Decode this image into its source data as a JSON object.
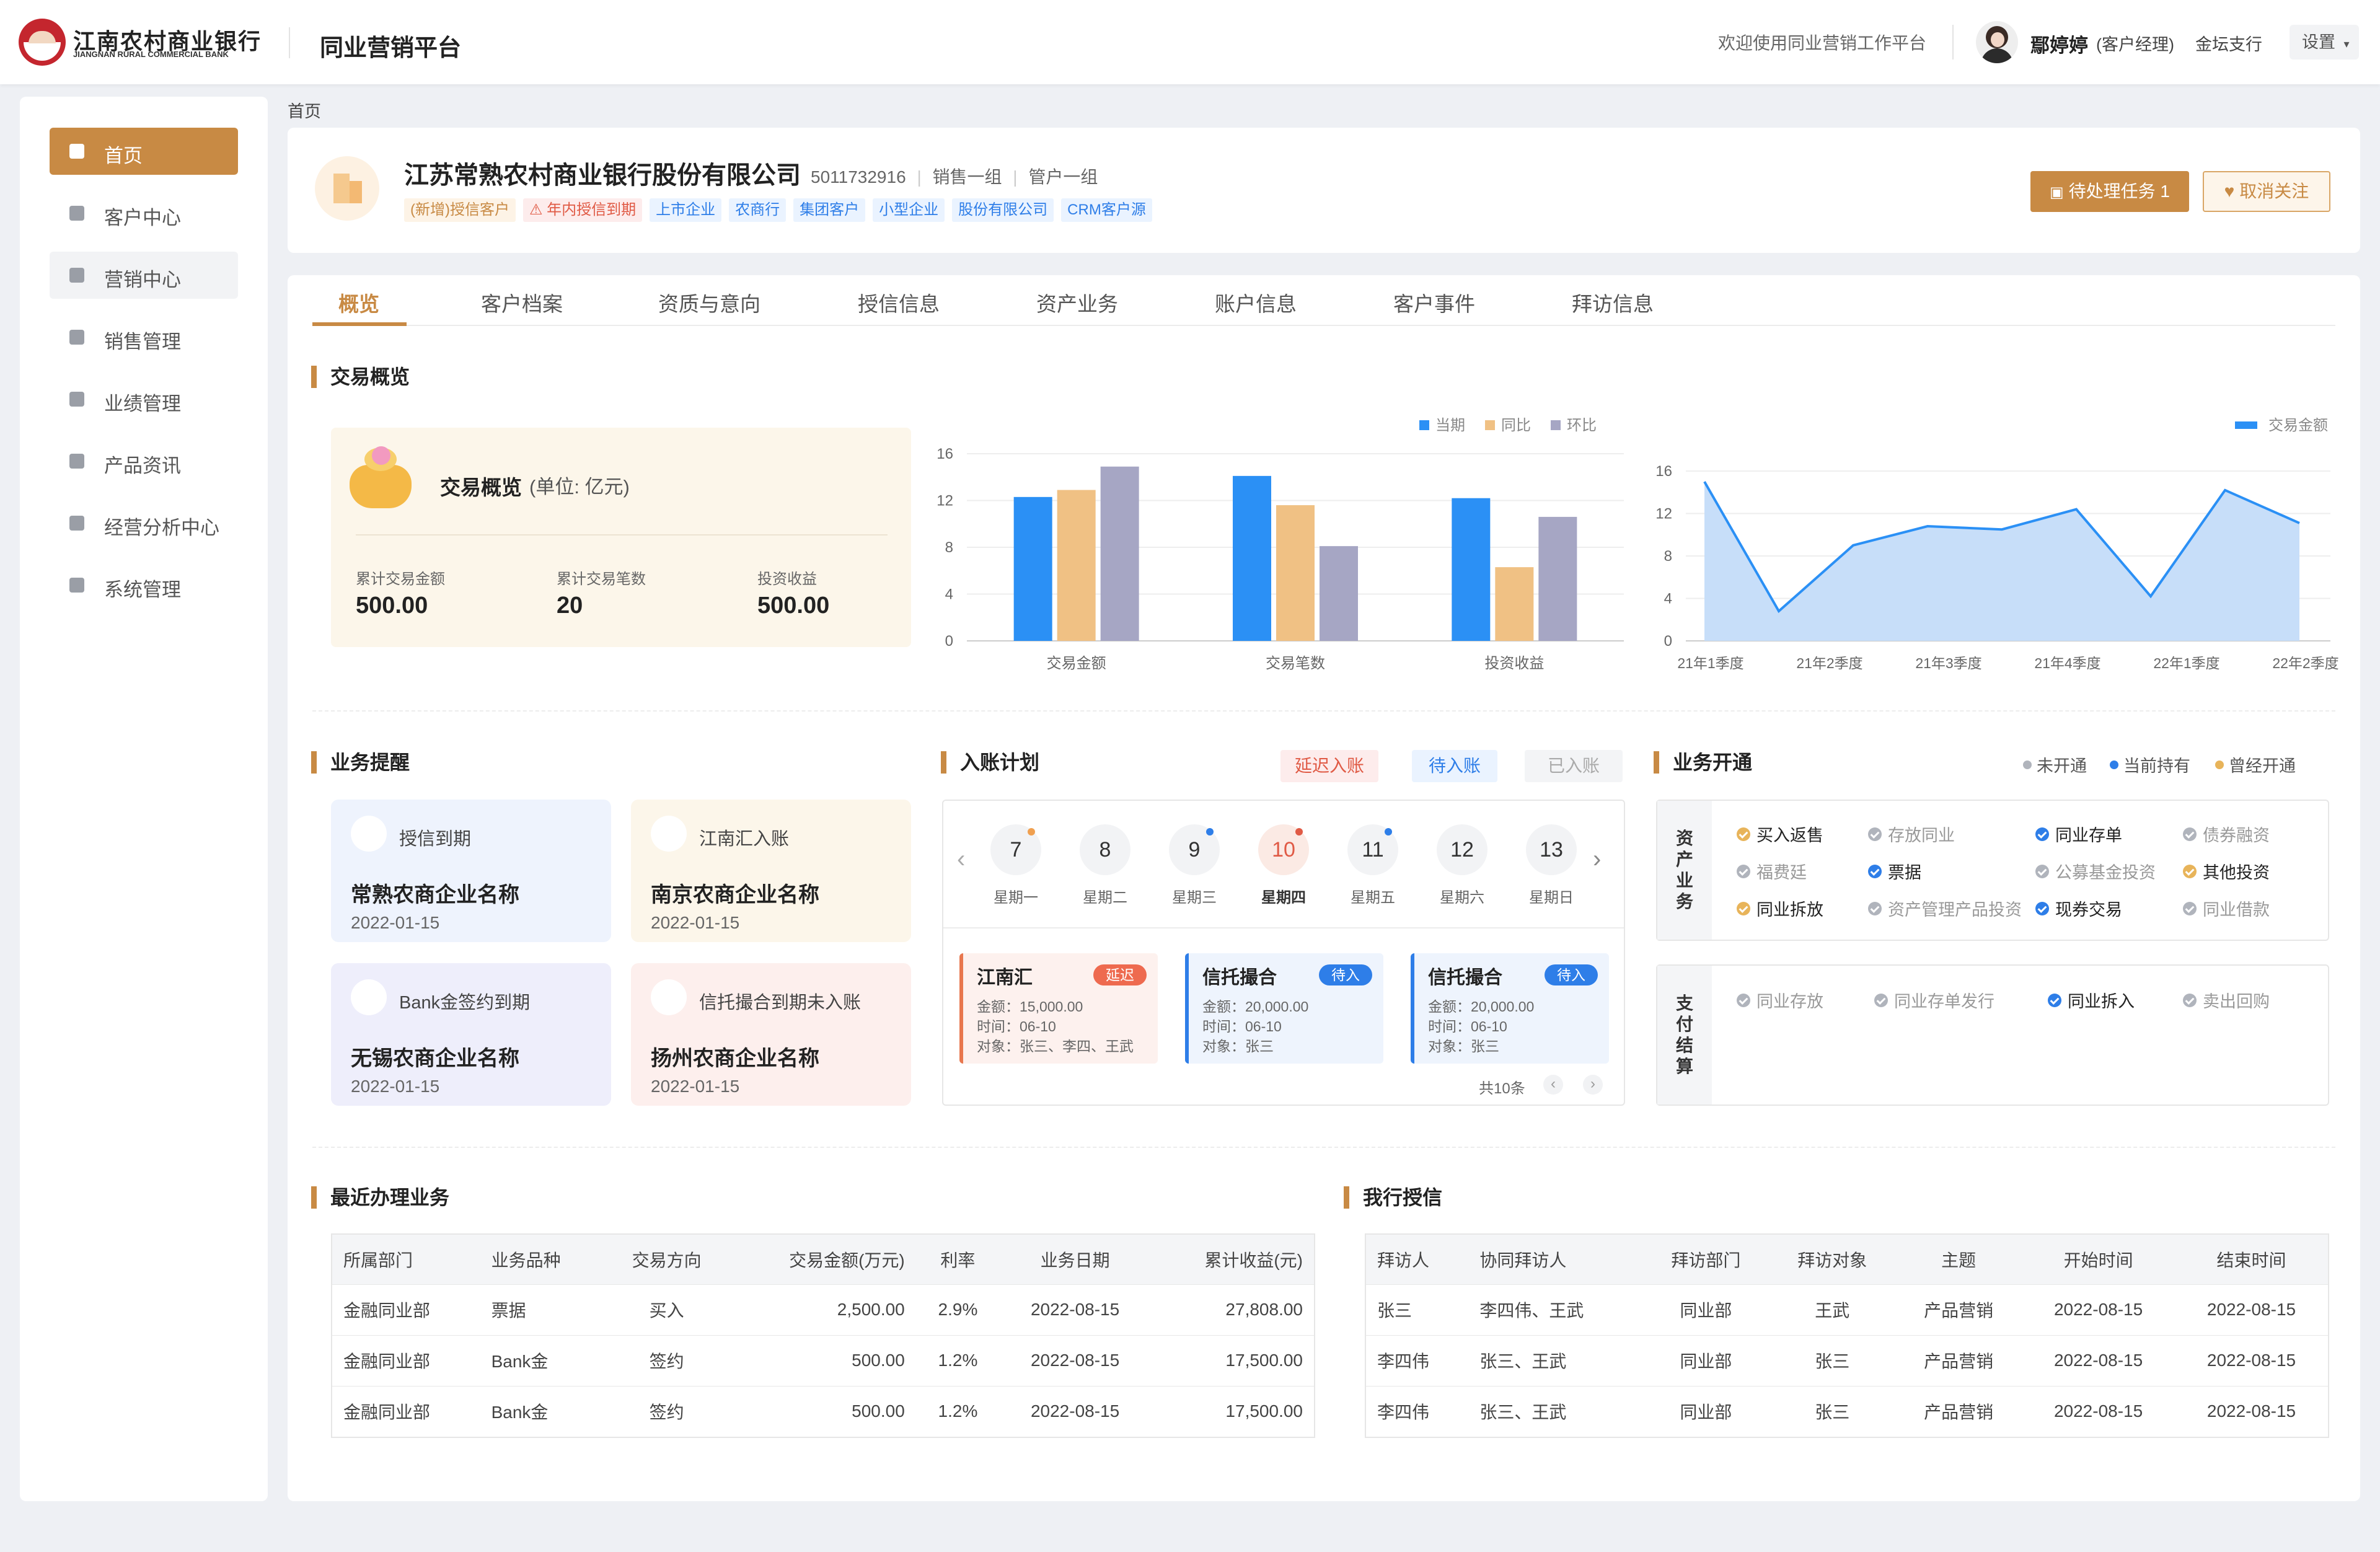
{
  "header": {
    "bank_name": "江南农村商业银行",
    "bank_name_en": "JIANGNAN RURAL COMMERCIAL BANK",
    "platform": "同业营销平台",
    "welcome": "欢迎使用同业营销工作平台",
    "user_name": "鄢婷婷",
    "user_role": "(客户经理)",
    "user_branch": "金坛支行",
    "settings": "设置"
  },
  "sidebar": {
    "items": [
      {
        "label": "首页",
        "icon": "home-icon",
        "active": true
      },
      {
        "label": "客户中心",
        "icon": "user-icon"
      },
      {
        "label": "营销中心",
        "icon": "tag-icon",
        "hover": true
      },
      {
        "label": "销售管理",
        "icon": "briefcase-icon"
      },
      {
        "label": "业绩管理",
        "icon": "clipboard-icon"
      },
      {
        "label": "产品资讯",
        "icon": "document-icon"
      },
      {
        "label": "经营分析中心",
        "icon": "chart-icon"
      },
      {
        "label": "系统管理",
        "icon": "gear-icon"
      }
    ]
  },
  "breadcrumb": "首页",
  "customer": {
    "name": "江苏常熟农村商业银行股份有限公司",
    "code": "5011732916",
    "group1": "销售一组",
    "group2": "管户一组",
    "tags": [
      {
        "text": "(新增)授信客户",
        "style": "orange"
      },
      {
        "text": "⚠ 年内授信到期",
        "style": "red"
      },
      {
        "text": "上市企业",
        "style": "blue"
      },
      {
        "text": "农商行",
        "style": "blue"
      },
      {
        "text": "集团客户",
        "style": "blue"
      },
      {
        "text": "小型企业",
        "style": "blue"
      },
      {
        "text": "股份有限公司",
        "style": "blue"
      },
      {
        "text": "CRM客户源",
        "style": "blue"
      }
    ],
    "task_button": "待处理任务 1",
    "unfollow_button": "取消关注"
  },
  "tabs": [
    "概览",
    "客户档案",
    "资质与意向",
    "授信信息",
    "资产业务",
    "账户信息",
    "客户事件",
    "拜访信息"
  ],
  "overview": {
    "title": "交易概览",
    "card_title": "交易概览",
    "card_unit": "(单位: 亿元)",
    "kpis": [
      {
        "label": "累计交易金额",
        "value": "500.00"
      },
      {
        "label": "累计交易笔数",
        "value": "20"
      },
      {
        "label": "投资收益",
        "value": "500.00"
      }
    ]
  },
  "chart_data": [
    {
      "type": "bar",
      "categories": [
        "交易金额",
        "交易笔数",
        "投资收益"
      ],
      "series": [
        {
          "name": "当期",
          "color": "#2b90f5",
          "values": [
            12.3,
            14.1,
            12.2
          ]
        },
        {
          "name": "同比",
          "color": "#f0c184",
          "values": [
            12.9,
            11.6,
            6.3
          ]
        },
        {
          "name": "环比",
          "color": "#a6a6c4",
          "values": [
            14.9,
            8.1,
            10.6
          ]
        }
      ],
      "yticks": [
        0,
        4,
        8,
        12,
        16
      ],
      "ylim": [
        0,
        16
      ],
      "legend": "top-right"
    },
    {
      "type": "area",
      "x": [
        "21年1季度",
        "21年2季度",
        "21年3季度",
        "21年4季度",
        "22年1季度",
        "22年2季度"
      ],
      "series": [
        {
          "name": "交易金额",
          "color": "#2b90f5",
          "values": [
            15,
            2.8,
            9,
            10.8,
            10.5,
            12.4,
            4.2,
            14.2,
            11.1
          ]
        }
      ],
      "yticks": [
        0,
        4,
        8,
        12,
        16
      ],
      "ylim": [
        0,
        16
      ],
      "legend": "top-right"
    }
  ],
  "reminders": {
    "title": "业务提醒",
    "cards": [
      {
        "type": "授信到期",
        "name": "常熟农商企业名称",
        "date": "2022-01-15",
        "bg": "#eef3fd",
        "icon": "yuan-icon"
      },
      {
        "type": "江南汇入账",
        "name": "南京农商企业名称",
        "date": "2022-01-15",
        "bg": "#fcf6ea",
        "icon": "coin-icon"
      },
      {
        "type": "Bank金签约到期",
        "name": "无锡农商企业名称",
        "date": "2022-01-15",
        "bg": "#eeeefb",
        "icon": "contract-icon"
      },
      {
        "type": "信托撮合到期未入账",
        "name": "扬州农商企业名称",
        "date": "2022-01-15",
        "bg": "#fdefed",
        "icon": "invoice-icon"
      }
    ]
  },
  "plan": {
    "title": "入账计划",
    "filters": [
      "延迟入账",
      "待入账",
      "已入账"
    ],
    "days": [
      {
        "num": "7",
        "wk": "星期一",
        "dot": "#f0a050"
      },
      {
        "num": "8",
        "wk": "星期二"
      },
      {
        "num": "9",
        "wk": "星期三",
        "dot": "#2e7ee8"
      },
      {
        "num": "10",
        "wk": "星期四",
        "dot": "#e05a45",
        "active": true
      },
      {
        "num": "11",
        "wk": "星期五",
        "dot": "#2e7ee8"
      },
      {
        "num": "12",
        "wk": "星期六"
      },
      {
        "num": "13",
        "wk": "星期日"
      }
    ],
    "events": [
      {
        "title": "江南汇",
        "badge": "延迟",
        "amount": "金额：15,000.00",
        "time": "时间：06-10",
        "target": "对象：张三、李四、王武"
      },
      {
        "title": "信托撮合",
        "badge": "待入",
        "amount": "金额：20,000.00",
        "time": "时间：06-10",
        "target": "对象：张三"
      },
      {
        "title": "信托撮合",
        "badge": "待入",
        "amount": "金额：20,000.00",
        "time": "时间：06-10",
        "target": "对象：张三"
      }
    ],
    "total": "共10条"
  },
  "open": {
    "title": "业务开通",
    "legend": [
      {
        "label": "未开通",
        "color": "#b0b4bc"
      },
      {
        "label": "当前持有",
        "color": "#2e7ee8"
      },
      {
        "label": "曾经开通",
        "color": "#e8b45a"
      }
    ],
    "asset_label": "资产业务",
    "pay_label": "支付结算",
    "asset_items": [
      {
        "label": "买入返售",
        "state": "past"
      },
      {
        "label": "存放同业",
        "state": "no"
      },
      {
        "label": "同业存单",
        "state": "hold"
      },
      {
        "label": "债券融资",
        "state": "no"
      },
      {
        "label": "福费廷",
        "state": "no"
      },
      {
        "label": "票据",
        "state": "hold"
      },
      {
        "label": "公募基金投资",
        "state": "no"
      },
      {
        "label": "其他投资",
        "state": "past"
      },
      {
        "label": "同业拆放",
        "state": "past"
      },
      {
        "label": "资产管理产品投资",
        "state": "no"
      },
      {
        "label": "现券交易",
        "state": "hold"
      },
      {
        "label": "同业借款",
        "state": "no"
      }
    ],
    "pay_items": [
      {
        "label": "同业存放",
        "state": "no"
      },
      {
        "label": "同业存单发行",
        "state": "no"
      },
      {
        "label": "同业拆入",
        "state": "hold"
      },
      {
        "label": "卖出回购",
        "state": "no"
      }
    ]
  },
  "recent": {
    "title": "最近办理业务",
    "headers": [
      "所属部门",
      "业务品种",
      "交易方向",
      "交易金额(万元)",
      "利率",
      "业务日期",
      "累计收益(元)"
    ],
    "rows": [
      [
        "金融同业部",
        "票据",
        "买入",
        "2,500.00",
        "2.9%",
        "2022-08-15",
        "27,808.00"
      ],
      [
        "金融同业部",
        "Bank金",
        "签约",
        "500.00",
        "1.2%",
        "2022-08-15",
        "17,500.00"
      ],
      [
        "金融同业部",
        "Bank金",
        "签约",
        "500.00",
        "1.2%",
        "2022-08-15",
        "17,500.00"
      ]
    ]
  },
  "credit": {
    "title": "我行授信",
    "headers": [
      "拜访人",
      "协同拜访人",
      "拜访部门",
      "拜访对象",
      "主题",
      "开始时间",
      "结束时间"
    ],
    "rows": [
      [
        "张三",
        "李四伟、王武",
        "同业部",
        "王武",
        "产品营销",
        "2022-08-15",
        "2022-08-15"
      ],
      [
        "李四伟",
        "张三、王武",
        "同业部",
        "张三",
        "产品营销",
        "2022-08-15",
        "2022-08-15"
      ],
      [
        "李四伟",
        "张三、王武",
        "同业部",
        "张三",
        "产品营销",
        "2022-08-15",
        "2022-08-15"
      ]
    ]
  }
}
